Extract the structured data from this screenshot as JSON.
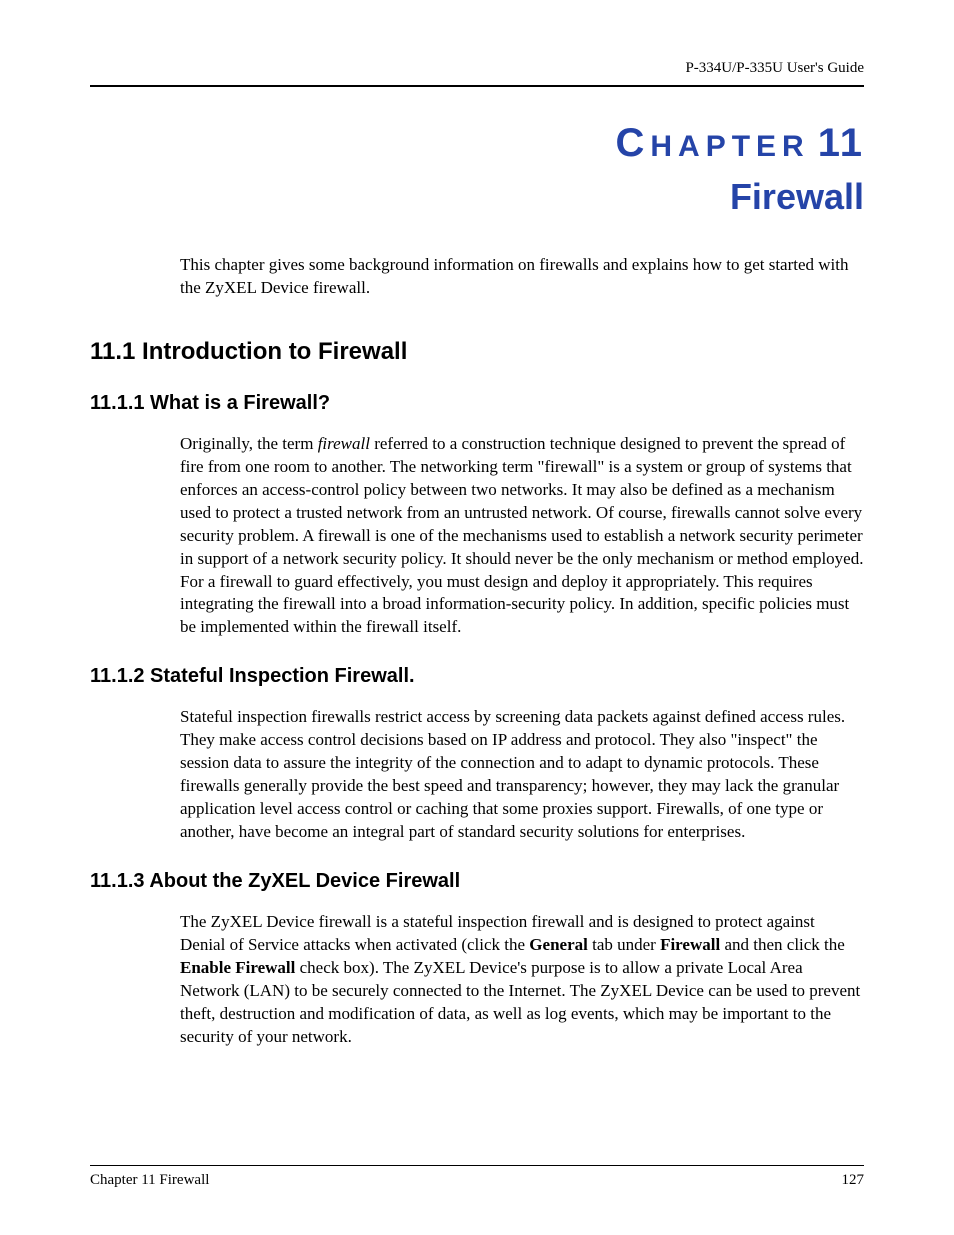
{
  "header": {
    "guide": "P-334U/P-335U User's Guide"
  },
  "chapter": {
    "labelCap": "C",
    "labelRest": "HAPTER",
    "number": "11",
    "title": "Firewall"
  },
  "intro": "This chapter gives some background information on firewalls and explains how to get started with the ZyXEL Device firewall.",
  "sections": {
    "s11_1": {
      "heading": "11.1  Introduction to Firewall"
    },
    "s11_1_1": {
      "heading": "11.1.1  What is a Firewall?",
      "p_pre": "Originally, the term ",
      "p_em": "firewall",
      "p_post": " referred to a construction technique designed to prevent the spread of fire from one room to another. The networking term \"firewall\" is a system or group of systems that enforces an access-control policy between two networks. It may also be defined as a mechanism used to protect a trusted network from an untrusted network. Of course, firewalls cannot solve every security problem. A firewall is one of the mechanisms used to establish a network security perimeter in support of a network security policy. It should never be the only mechanism or method employed. For a firewall to guard effectively, you must design and deploy it appropriately. This requires integrating the firewall into a broad information-security policy. In addition, specific policies must be implemented within the firewall itself."
    },
    "s11_1_2": {
      "heading": "11.1.2  Stateful Inspection Firewall.",
      "p": "Stateful inspection firewalls restrict access by screening data packets against defined access rules. They make access control decisions based on IP address and protocol. They also \"inspect\" the session data to assure the integrity of the connection and to adapt to dynamic protocols. These firewalls generally provide the best speed and transparency; however, they may lack the granular application level access control or caching that some proxies support. Firewalls, of one type or another, have become an integral part of standard security solutions for enterprises."
    },
    "s11_1_3": {
      "heading": "11.1.3  About the ZyXEL Device Firewall",
      "p_1": "The ZyXEL Device firewall is a stateful inspection firewall and is designed to protect against Denial of Service attacks when activated (click the ",
      "b1": "General",
      "p_2": " tab under ",
      "b2": "Firewall",
      "p_3": " and then click the ",
      "b3": "Enable Firewall",
      "p_4": " check box). The ZyXEL Device's purpose is to allow a private Local Area Network (LAN) to be securely connected to the Internet. The ZyXEL Device can be used to prevent theft, destruction and modification of data, as well as log events, which may be important to the security of your network."
    }
  },
  "footer": {
    "left": "Chapter 11 Firewall",
    "right": "127"
  }
}
